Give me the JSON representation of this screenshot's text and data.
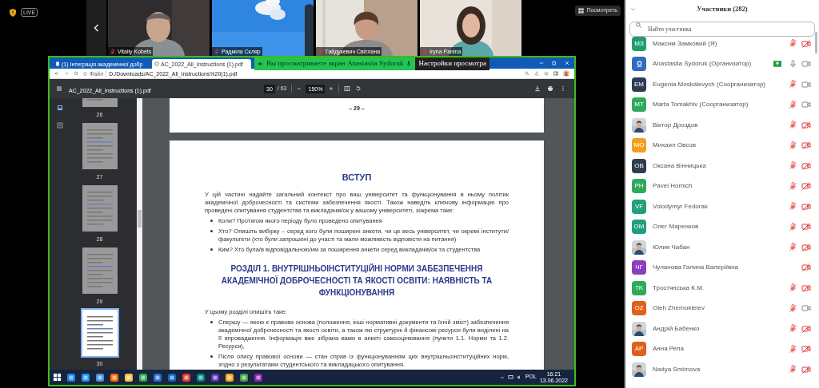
{
  "meeting": {
    "live_badge": "LIVE",
    "view_button": "Посмотреть"
  },
  "videos": [
    {
      "name": "Vitaliy Kobets",
      "muted": true,
      "kind": "person-dark"
    },
    {
      "name": "Радміла Скляр",
      "muted": true,
      "kind": "sky"
    },
    {
      "name": "Гайдукевич Світлана",
      "muted": true,
      "kind": "person-window"
    },
    {
      "name": "Iryna Panina",
      "muted": true,
      "kind": "person-light"
    }
  ],
  "share_banner": {
    "text": "Вы просматриваете экран Anastasiia Sydoruk",
    "settings": "Настройки просмотра"
  },
  "browser": {
    "tabs": [
      {
        "label": "(1) Інтеграція академічної добр",
        "selected": false
      },
      {
        "label": "AC_2022_All_Instructions (1).pdf",
        "selected": true
      }
    ],
    "url_scheme": "Файл",
    "url": "D:/Downloads/AC_2022_All_Instructions%20(1).pdf"
  },
  "pdf": {
    "title": "AC_2022_All_Instructions (1).pdf",
    "page": "30",
    "page_total": "/ 63",
    "zoom": "150%",
    "thumbnails": [
      {
        "label": "26",
        "selected": false
      },
      {
        "label": "27",
        "selected": false
      },
      {
        "label": "28",
        "selected": false
      },
      {
        "label": "29",
        "selected": false
      },
      {
        "label": "30",
        "selected": true
      }
    ],
    "previous_page_number": "– 29 –",
    "page_content": [
      {
        "kind": "heading",
        "text": "ВСТУП"
      },
      {
        "kind": "paragraph",
        "text": "У цій частині надайте загальний контекст про ваш університет та функціонування в ньому політик академічної доброчесності та системи забезпечення якості. Також наведіть ключову інформацію про проведені опитування студентства та викладачів/ок у вашому університеті, зокрема таке:"
      },
      {
        "kind": "bullet",
        "text": "Коли? Протягом якого періоду було проведено опитування"
      },
      {
        "kind": "bullet",
        "text": "Хто? Опишіть вибірку – серед кого були поширені анкети, чи це весь університет, чи окремі інститути/факультети (хто були запрошені до участі та мали можливість відповісти на питання)"
      },
      {
        "kind": "bullet",
        "text": "Ким? Хто була/в відповідальною/им за поширення анкети серед викладачів/ок та студентства"
      },
      {
        "kind": "section_heading",
        "text": "РОЗДІЛ 1. ВНУТРІШНЬОІНСТИТУЦІЙНІ НОРМИ ЗАБЕЗПЕЧЕННЯ АКАДЕМІЧНОЇ ДОБРОЧЕСНОСТІ ТА ЯКОСТІ ОСВІТИ: НАЯВНІСТЬ ТА ФУНКЦІОНУВАННЯ"
      },
      {
        "kind": "paragraph",
        "text": "У цьому розділі опишіть таке:"
      },
      {
        "kind": "bullet",
        "text": "Спершу — якою є правова основа (положення, інші нормативні документи та їхній зміст) забезпечення академічної доброчесності та якості освіти, а також які структурні й фінансові ресурси були виділені на її впровадження. Інформація вже зібрана вами в анкеті самооцінювання (пункти 1.1. Норми та 1.2. Ресурси),"
      },
      {
        "kind": "bullet",
        "text": "Після опису правової основи — стан справ із функціонуванням цих внутрішньоінституційних норм, згідно з результатами студентського та викладацького опитування."
      }
    ]
  },
  "taskbar": {
    "language": "POL",
    "time": "16:21",
    "date": "13.06.2022"
  },
  "participants": {
    "title": "Участники (282)",
    "search_placeholder": "Найти участника",
    "items": [
      {
        "kind": "initials",
        "initials": "МЗ",
        "color": "#1f9d6e",
        "name": "Максим Замковий (Я)",
        "audio": true,
        "muted": true,
        "camera_on": false,
        "sharing": false
      },
      {
        "kind": "logo",
        "color": "#2f6dc0",
        "name": "Anastasiia Sydoruk (Организатор)",
        "audio": true,
        "muted": false,
        "camera_on": true,
        "sharing": true
      },
      {
        "kind": "initials",
        "initials": "EM",
        "color": "#2e3e52",
        "name": "Eugenia Moskalevych (Соорганизатор)",
        "audio": true,
        "muted": true,
        "camera_on": true,
        "sharing": false
      },
      {
        "kind": "initials",
        "initials": "MT",
        "color": "#2eaa5c",
        "name": "Marta Tomakhiv (Соорганизатор)",
        "audio": true,
        "muted": true,
        "camera_on": true,
        "sharing": false
      },
      {
        "name": "Віктор Дроздов",
        "audio": true,
        "muted": true,
        "camera_on": false,
        "sharing": false
      },
      {
        "kind": "initials",
        "initials": "MO",
        "color": "#f0a01e",
        "name": "Михаил Овсов",
        "audio": true,
        "muted": true,
        "camera_on": false,
        "sharing": false
      },
      {
        "kind": "initials",
        "initials": "OB",
        "color": "#2e3e52",
        "name": "Оксана Вінницька",
        "audio": true,
        "muted": true,
        "camera_on": false,
        "sharing": false
      },
      {
        "kind": "initials",
        "initials": "PH",
        "color": "#2eaa5c",
        "name": "Pavel Homich",
        "audio": true,
        "muted": true,
        "camera_on": false,
        "sharing": false
      },
      {
        "kind": "initials",
        "initials": "VF",
        "color": "#22a07a",
        "name": "Volodymyr Fedorak",
        "audio": true,
        "muted": true,
        "camera_on": false,
        "sharing": false
      },
      {
        "kind": "initials",
        "initials": "OM",
        "color": "#1e9e7e",
        "name": "Олег Маренков",
        "audio": true,
        "muted": true,
        "camera_on": false,
        "sharing": false
      },
      {
        "name": "Юлия Чабан",
        "audio": true,
        "muted": true,
        "camera_on": false,
        "sharing": false
      },
      {
        "kind": "initials",
        "initials": "ЧГ",
        "color": "#8a3fc0",
        "name": "Чуланова Галина Валеріївна",
        "audio": false,
        "camera_on": false,
        "sharing": false
      },
      {
        "kind": "initials",
        "initials": "TK",
        "color": "#2eaa5c",
        "name": "Тростянська К.М.",
        "audio": true,
        "muted": true,
        "camera_on": false,
        "sharing": false
      },
      {
        "kind": "initials",
        "initials": "OZ",
        "color": "#e0601a",
        "name": "Oleh Zhernokleiev",
        "audio": true,
        "muted": true,
        "camera_on": true,
        "sharing": false
      },
      {
        "name": "Андрій Бабенко",
        "audio": true,
        "muted": true,
        "camera_on": false,
        "sharing": false
      },
      {
        "kind": "initials",
        "initials": "AP",
        "color": "#e0601a",
        "name": "Анна Репа",
        "audio": true,
        "muted": true,
        "camera_on": false,
        "sharing": false
      },
      {
        "name": "Nadya Smirnova",
        "audio": true,
        "muted": true,
        "camera_on": false,
        "sharing": false
      }
    ]
  }
}
